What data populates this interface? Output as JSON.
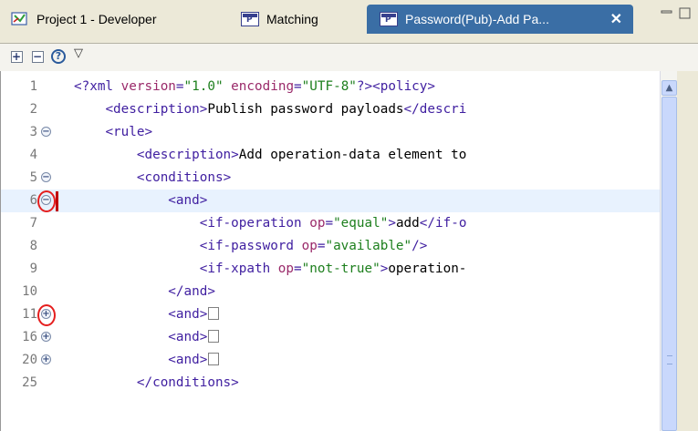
{
  "tabs": [
    {
      "label": "Project 1 - Developer",
      "icon": "developer-project-icon"
    },
    {
      "label": "Matching",
      "icon": "policy-editor-icon"
    },
    {
      "label": "Password(Pub)-Add Pa...",
      "icon": "policy-editor-icon",
      "active": true,
      "close": "✕"
    }
  ],
  "toolbar": {
    "expand_all": "+",
    "collapse_all": "−",
    "help": "?",
    "menu": "▽"
  },
  "editor": {
    "lines": [
      {
        "num": "1",
        "fold": "",
        "code": "<?xml version=\"1.0\" encoding=\"UTF-8\"?><policy>"
      },
      {
        "num": "2",
        "fold": "",
        "code": "    <description>Publish password payloads</descri"
      },
      {
        "num": "3",
        "fold": "−",
        "code": "    <rule>"
      },
      {
        "num": "4",
        "fold": "",
        "code": "        <description>Add operation-data element to"
      },
      {
        "num": "5",
        "fold": "−",
        "code": "        <conditions>"
      },
      {
        "num": "6",
        "fold": "−",
        "code": "            <and>"
      },
      {
        "num": "7",
        "fold": "",
        "code": "                <if-operation op=\"equal\">add</if-o"
      },
      {
        "num": "8",
        "fold": "",
        "code": "                <if-password op=\"available\"/>"
      },
      {
        "num": "9",
        "fold": "",
        "code": "                <if-xpath op=\"not-true\">operation-"
      },
      {
        "num": "10",
        "fold": "",
        "code": "            </and>"
      },
      {
        "num": "11",
        "fold": "+",
        "code": "            <and>"
      },
      {
        "num": "16",
        "fold": "+",
        "code": "            <and>"
      },
      {
        "num": "20",
        "fold": "+",
        "code": "            <and>"
      },
      {
        "num": "25",
        "fold": "",
        "code": "        </conditions>"
      }
    ]
  },
  "colors": {
    "active_tab": "#3a6ea5",
    "highlight_line": "#e8f2fe",
    "tag": "#3f1ea0",
    "attribute": "#9a2a6a",
    "value": "#1d7f1d",
    "annotation": "#e51e1e"
  }
}
